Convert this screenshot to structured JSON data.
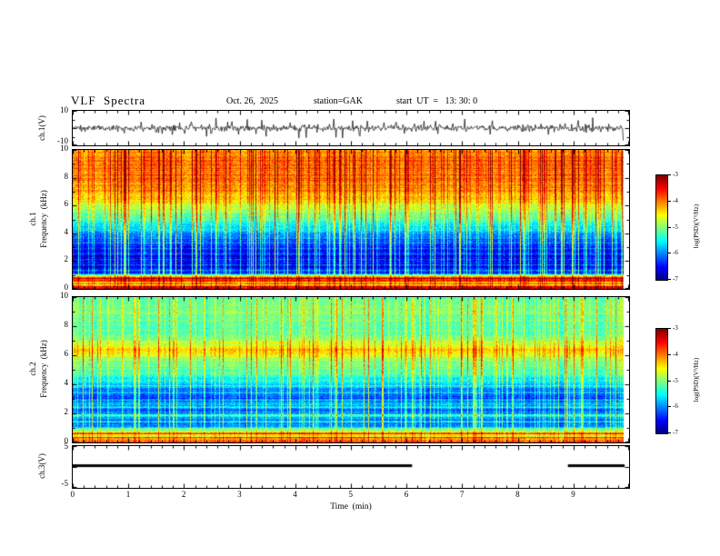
{
  "header": {
    "title": "VLF  Spectra",
    "date": "Oct. 26,  2025",
    "station": "station=GAK",
    "start_ut": "start  UT  =   13: 30: 0"
  },
  "axes": {
    "x_label": "Time  (min)",
    "x_ticks": [
      "0",
      "1",
      "2",
      "3",
      "4",
      "5",
      "6",
      "7",
      "8",
      "9"
    ],
    "x_range": [
      0,
      10
    ]
  },
  "panels": {
    "waveform": {
      "ylabel": "ch.1(V)",
      "ytop": "10",
      "ybottom": "-10"
    },
    "spec1": {
      "channel": "ch.1",
      "ylabel": "Frequency  (kHz)",
      "yticks": [
        "0",
        "2",
        "4",
        "6",
        "8",
        "10"
      ]
    },
    "spec2": {
      "channel": "ch.2",
      "ylabel": "Frequency  (kHz)",
      "yticks": [
        "0",
        "2",
        "4",
        "6",
        "8",
        "10"
      ]
    },
    "ch3": {
      "ylabel": "ch.3(V)",
      "ytop": "5",
      "ybottom": "-5"
    }
  },
  "colorbar": {
    "label": "log(PSD)(V²/Hz)",
    "ticks": [
      "-3",
      "-4",
      "-5",
      "-6",
      "-7"
    ],
    "range": [
      -7,
      -3
    ]
  },
  "chart_data": [
    {
      "type": "line",
      "name": "ch1_time_series",
      "ylabel": "ch.1(V)",
      "x_range": [
        0,
        10
      ],
      "x_end_of_data": 9.9,
      "y_range": [
        -10,
        10
      ],
      "noise_sigma": 2.0,
      "spike_probability": 0.05,
      "spike_min": 3,
      "spike_max": 9.2,
      "description": "zero-mean broadband noise ~±2 V with frequent impulsive spikes reaching ±9 V over the full 9.9 min record"
    },
    {
      "type": "heatmap",
      "name": "ch1_vlf_spectrogram",
      "ylabel": "ch.1 Frequency (kHz)",
      "x_range": [
        0,
        10
      ],
      "x_end_of_data": 9.9,
      "y_range": [
        0,
        10
      ],
      "z_label": "log(PSD)(V²/Hz)",
      "z_range": [
        -7,
        -3
      ],
      "colormap": "jet",
      "freq_profile": [
        [
          0.0,
          -3.3
        ],
        [
          0.15,
          -3.6
        ],
        [
          0.3,
          -4.8
        ],
        [
          0.5,
          -4.2
        ],
        [
          0.62,
          -3.7
        ],
        [
          0.78,
          -4.0
        ],
        [
          0.92,
          -4.8
        ],
        [
          1.1,
          -6.3
        ],
        [
          1.6,
          -6.6
        ],
        [
          2.4,
          -6.6
        ],
        [
          3.2,
          -6.35
        ],
        [
          4.0,
          -5.9
        ],
        [
          4.8,
          -5.4
        ],
        [
          5.6,
          -4.9
        ],
        [
          6.4,
          -4.4
        ],
        [
          7.2,
          -4.1
        ],
        [
          8.2,
          -3.95
        ],
        [
          9.2,
          -3.95
        ],
        [
          10.0,
          -4.15
        ]
      ],
      "stripe_lines": [
        [
          0.35,
          0.05,
          0.9
        ],
        [
          0.55,
          0.04,
          0.7
        ],
        [
          0.75,
          0.04,
          1.1
        ],
        [
          1.3,
          0.05,
          0.5
        ],
        [
          1.7,
          0.05,
          0.45
        ],
        [
          2.1,
          0.04,
          0.5
        ],
        [
          2.5,
          0.04,
          0.45
        ],
        [
          2.9,
          0.04,
          0.4
        ],
        [
          3.3,
          0.04,
          0.35
        ]
      ],
      "streaks": {
        "probability": 0.3,
        "amp_min": 0.3,
        "amp_max": 1.8
      },
      "col_weight": [
        [
          1,
          0.45
        ],
        [
          5.5,
          1.0
        ],
        [
          10,
          0.75
        ]
      ],
      "noise_amp": 0.55,
      "description": "intense red band below 1 kHz, dark blue 1-4 kHz crossed by dense vertical sferic streaks, green 4-6 kHz, yellow-red above 6 kHz"
    },
    {
      "type": "heatmap",
      "name": "ch2_vlf_spectrogram",
      "ylabel": "ch.2 Frequency (kHz)",
      "x_range": [
        0,
        10
      ],
      "x_end_of_data": 9.9,
      "y_range": [
        0,
        10
      ],
      "z_label": "log(PSD)(V²/Hz)",
      "z_range": [
        -7,
        -3
      ],
      "colormap": "jet",
      "freq_profile": [
        [
          0.0,
          -3.8
        ],
        [
          0.2,
          -4.1
        ],
        [
          0.35,
          -4.7
        ],
        [
          0.55,
          -4.3
        ],
        [
          0.8,
          -4.9
        ],
        [
          1.05,
          -5.9
        ],
        [
          1.5,
          -6.1
        ],
        [
          1.85,
          -5.7
        ],
        [
          2.2,
          -6.2
        ],
        [
          2.6,
          -5.8
        ],
        [
          3.0,
          -6.25
        ],
        [
          3.5,
          -6.1
        ],
        [
          4.1,
          -5.6
        ],
        [
          4.8,
          -5.25
        ],
        [
          5.5,
          -5.05
        ],
        [
          6.1,
          -4.55
        ],
        [
          6.6,
          -4.5
        ],
        [
          7.1,
          -5.0
        ],
        [
          8.0,
          -5.15
        ],
        [
          9.0,
          -5.0
        ],
        [
          10.0,
          -5.15
        ]
      ],
      "stripe_lines": [
        [
          0.3,
          0.05,
          0.8
        ],
        [
          0.6,
          0.05,
          0.9
        ],
        [
          0.9,
          0.04,
          0.5
        ],
        [
          1.4,
          0.05,
          0.5
        ],
        [
          1.85,
          0.06,
          0.6
        ],
        [
          2.4,
          0.05,
          0.55
        ],
        [
          2.9,
          0.05,
          0.5
        ],
        [
          3.4,
          0.05,
          0.45
        ],
        [
          3.9,
          0.04,
          0.4
        ],
        [
          6.35,
          0.15,
          0.3
        ]
      ],
      "streaks": {
        "probability": 0.26,
        "amp_min": 0.3,
        "amp_max": 1.4
      },
      "col_weight": [
        [
          1,
          0.5
        ],
        [
          6,
          1.0
        ],
        [
          10,
          0.8
        ]
      ],
      "noise_amp": 0.5,
      "description": "cyan-green overall; blue 1-4 kHz with cyan stripes, yellow-green band near 6.3 kHz, green above 7 kHz, vertical sferic streaks"
    },
    {
      "type": "line",
      "name": "ch3_time_series",
      "ylabel": "ch.3(V)",
      "x_range": [
        0,
        10
      ],
      "y_range": [
        -5,
        5
      ],
      "value_v": 0.3,
      "segments_min": [
        [
          0,
          6.1
        ],
        [
          8.9,
          9.92
        ]
      ],
      "description": "constant level ~0.3 V drawn as a thick bar, with a data gap between 6.1 and 8.9 min"
    }
  ]
}
